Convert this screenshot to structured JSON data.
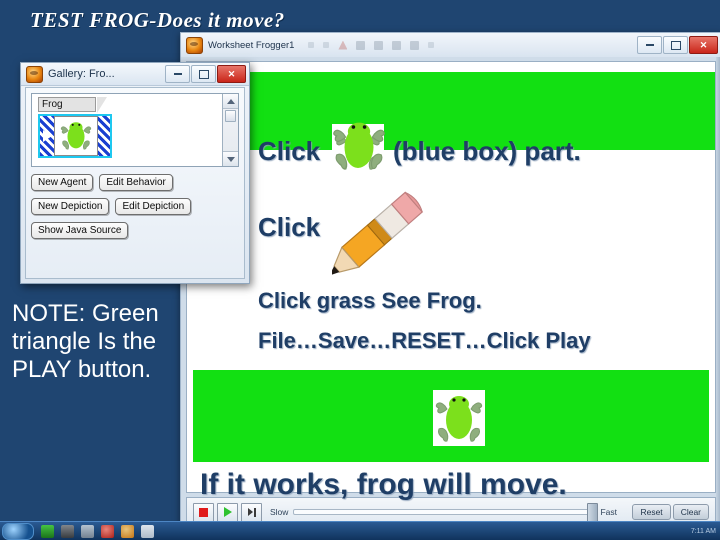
{
  "slide": {
    "title": "TEST FROG-Does it move?",
    "background_color": "#1f4571",
    "note_text": "NOTE: Green triangle Is the PLAY button."
  },
  "worksheet_window": {
    "title": "Worksheet Frogger1",
    "app_icon": "frogger-app-icon",
    "controls": {
      "minimize": "minimize",
      "maximize": "maximize",
      "close": "close"
    },
    "toolbar": {
      "stop_label": "stop",
      "play_label": "play",
      "step_label": "step",
      "slow_label": "Slow",
      "fast_label": "Fast",
      "reset_label": "Reset",
      "clear_label": "Clear"
    },
    "canvas": {
      "grass_color": "#12e012",
      "frog_body_color": "#7ce01c",
      "frog_limb_color": "#8fae7e"
    }
  },
  "gallery_dialog": {
    "title": "Gallery: Fro...",
    "app_icon": "frogger-app-icon",
    "controls": {
      "minimize": "minimize",
      "maximize": "maximize",
      "close": "close"
    },
    "tab_label": "Frog",
    "selected_cell": "frog-depiction-blue-box",
    "buttons": [
      "New Agent",
      "Edit Behavior",
      "New Depiction",
      "Edit Depiction",
      "Show Java Source"
    ]
  },
  "instructions": {
    "click_1": "Click",
    "blue_box": "(blue box) part.",
    "click_2": "Click",
    "click_grass": "Click grass  See Frog.",
    "file_save": "File…Save…RESET…Click Play",
    "works": "If it works, frog will move."
  },
  "taskbar": {
    "clock": "7:11 AM"
  }
}
